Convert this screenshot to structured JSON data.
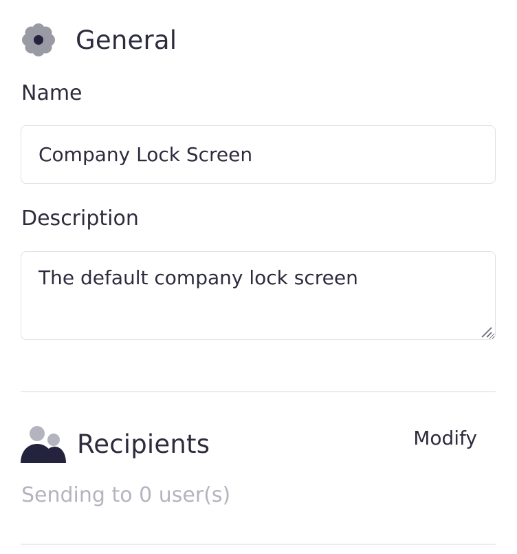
{
  "general": {
    "title": "General",
    "icon": "gear-icon"
  },
  "name_field": {
    "label": "Name",
    "value": "Company Lock Screen"
  },
  "description_field": {
    "label": "Description",
    "value": "The default company lock screen"
  },
  "recipients": {
    "title": "Recipients",
    "icon": "users-icon",
    "modify_label": "Modify",
    "status": "Sending to 0 user(s)"
  },
  "colors": {
    "text": "#2c2c3e",
    "muted_text": "#b4b4bf",
    "icon_gray": "#9a9aa5",
    "icon_dark": "#23233d",
    "border": "#e0e0e6",
    "divider": "#ececf0"
  }
}
